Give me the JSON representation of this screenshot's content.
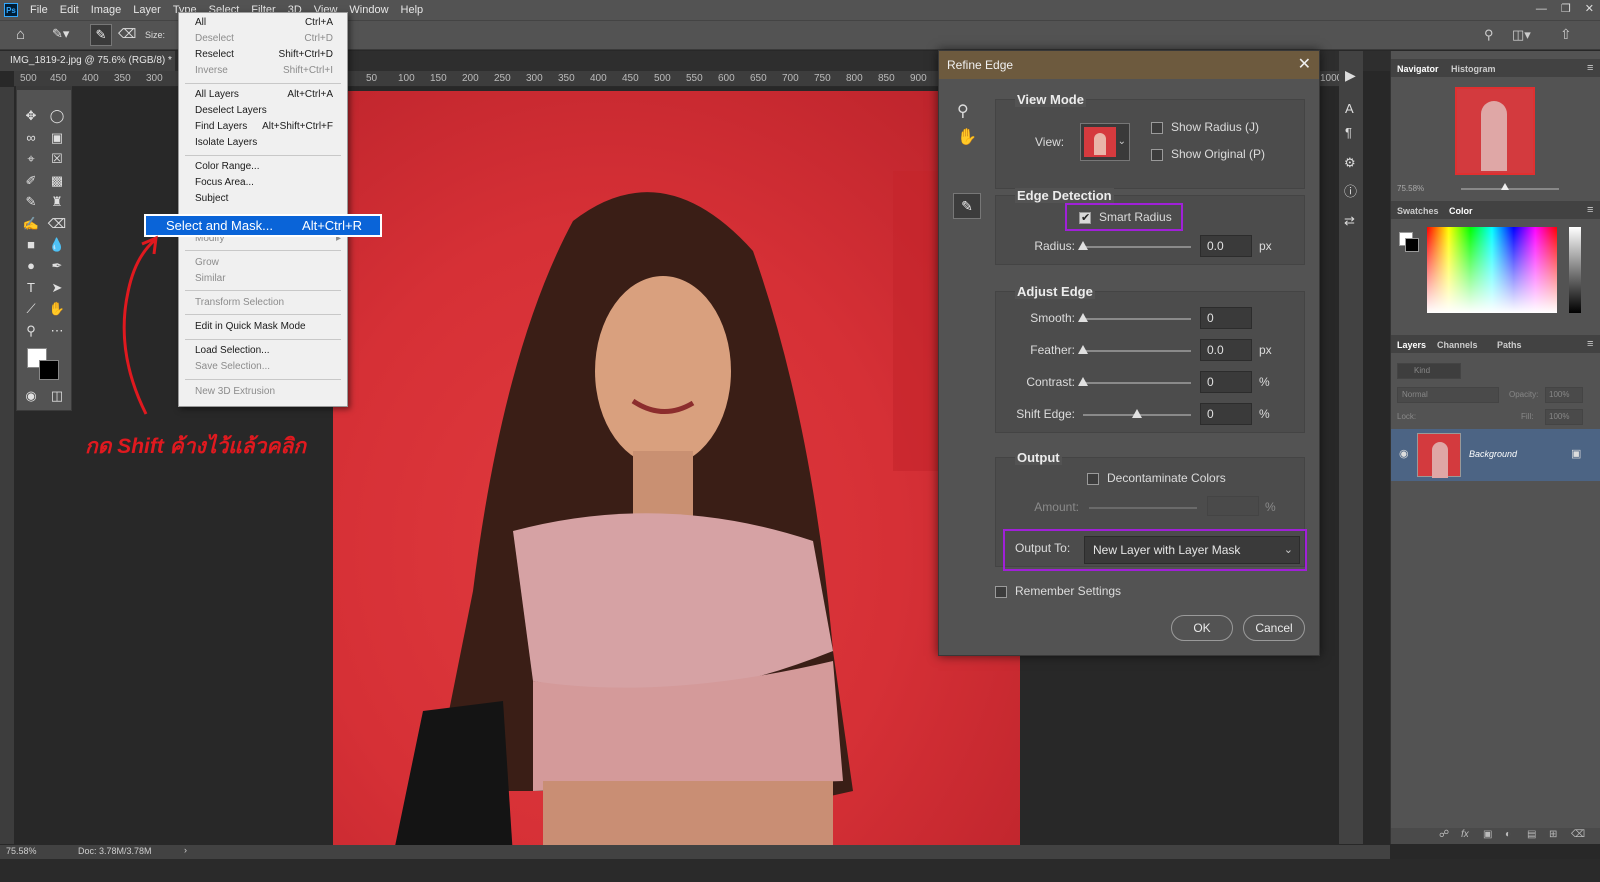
{
  "app": {
    "logo": "Ps"
  },
  "menubar": {
    "items": [
      "File",
      "Edit",
      "Image",
      "Layer",
      "Type",
      "Select",
      "Filter",
      "3D",
      "View",
      "Window",
      "Help"
    ]
  },
  "options": {
    "size_label": "Size:"
  },
  "document": {
    "tab_title": "IMG_1819-2.jpg @ 75.6% (RGB/8) *"
  },
  "ruler_top_labels": [
    "500",
    "450",
    "400",
    "350",
    "300",
    "50",
    "100",
    "150",
    "200",
    "250",
    "300",
    "350",
    "400",
    "450",
    "500",
    "550",
    "600",
    "650",
    "700",
    "750",
    "800",
    "850",
    "900",
    "950",
    "1000"
  ],
  "select_menu": {
    "items": [
      {
        "label": "All",
        "shortcut": "Ctrl+A",
        "disabled": false
      },
      {
        "label": "Deselect",
        "shortcut": "Ctrl+D",
        "disabled": true
      },
      {
        "label": "Reselect",
        "shortcut": "Shift+Ctrl+D",
        "disabled": false
      },
      {
        "label": "Inverse",
        "shortcut": "Shift+Ctrl+I",
        "disabled": true
      },
      {
        "label": "All Layers",
        "shortcut": "Alt+Ctrl+A",
        "disabled": false
      },
      {
        "label": "Deselect Layers",
        "shortcut": "",
        "disabled": false
      },
      {
        "label": "Find Layers",
        "shortcut": "Alt+Shift+Ctrl+F",
        "disabled": false
      },
      {
        "label": "Isolate Layers",
        "shortcut": "",
        "disabled": false
      },
      {
        "label": "Color Range...",
        "shortcut": "",
        "disabled": false
      },
      {
        "label": "Focus Area...",
        "shortcut": "",
        "disabled": false
      },
      {
        "label": "Subject",
        "shortcut": "",
        "disabled": false
      },
      {
        "label": "Modify",
        "shortcut": "",
        "disabled": true
      },
      {
        "label": "Grow",
        "shortcut": "",
        "disabled": true
      },
      {
        "label": "Similar",
        "shortcut": "",
        "disabled": true
      },
      {
        "label": "Transform Selection",
        "shortcut": "",
        "disabled": true
      },
      {
        "label": "Edit in Quick Mask Mode",
        "shortcut": "",
        "disabled": false
      },
      {
        "label": "Load Selection...",
        "shortcut": "",
        "disabled": false
      },
      {
        "label": "Save Selection...",
        "shortcut": "",
        "disabled": true
      },
      {
        "label": "New 3D Extrusion",
        "shortcut": "",
        "disabled": true
      }
    ],
    "highlighted": {
      "label": "Select and Mask...",
      "shortcut": "Alt+Ctrl+R"
    }
  },
  "annotation": {
    "text": "กด Shift ค้างไว้แล้วคลิก",
    "color": "#e0191f"
  },
  "dialog": {
    "title": "Refine Edge",
    "view_mode": {
      "title": "View Mode",
      "view_label": "View:",
      "show_radius": "Show Radius (J)",
      "show_original": "Show Original (P)"
    },
    "edge_detection": {
      "title": "Edge Detection",
      "smart_radius": "Smart Radius",
      "smart_radius_checked": true,
      "radius_label": "Radius:",
      "radius_value": "0.0",
      "radius_unit": "px",
      "radius_pos": 0
    },
    "adjust_edge": {
      "title": "Adjust Edge",
      "rows": [
        {
          "label": "Smooth:",
          "value": "0",
          "unit": "",
          "pos": 0
        },
        {
          "label": "Feather:",
          "value": "0.0",
          "unit": "px",
          "pos": 0
        },
        {
          "label": "Contrast:",
          "value": "0",
          "unit": "%",
          "pos": 0
        },
        {
          "label": "Shift Edge:",
          "value": "0",
          "unit": "%",
          "pos": 0.5
        }
      ]
    },
    "output": {
      "title": "Output",
      "decontaminate": "Decontaminate Colors",
      "amount_label": "Amount:",
      "amount_unit": "%",
      "output_to_label": "Output To:",
      "output_to_value": "New Layer with Layer Mask"
    },
    "remember": "Remember Settings",
    "ok": "OK",
    "cancel": "Cancel",
    "highlight_color": "#a020d8"
  },
  "panels": {
    "nav_tabs": [
      "Navigator",
      "Histogram"
    ],
    "nav_zoom": "75.58%",
    "color_tabs": [
      "Swatches",
      "Color"
    ],
    "layer_tabs": [
      "Layers",
      "Channels",
      "Paths"
    ],
    "kind_label": "Kind",
    "blend_mode": "Normal",
    "opacity_label": "Opacity:",
    "opacity_value": "100%",
    "lock_label": "Lock:",
    "fill_label": "Fill:",
    "fill_value": "100%",
    "layer_name": "Background"
  },
  "status": {
    "zoom": "75.58%",
    "doc": "Doc: 3.78M/3.78M"
  }
}
